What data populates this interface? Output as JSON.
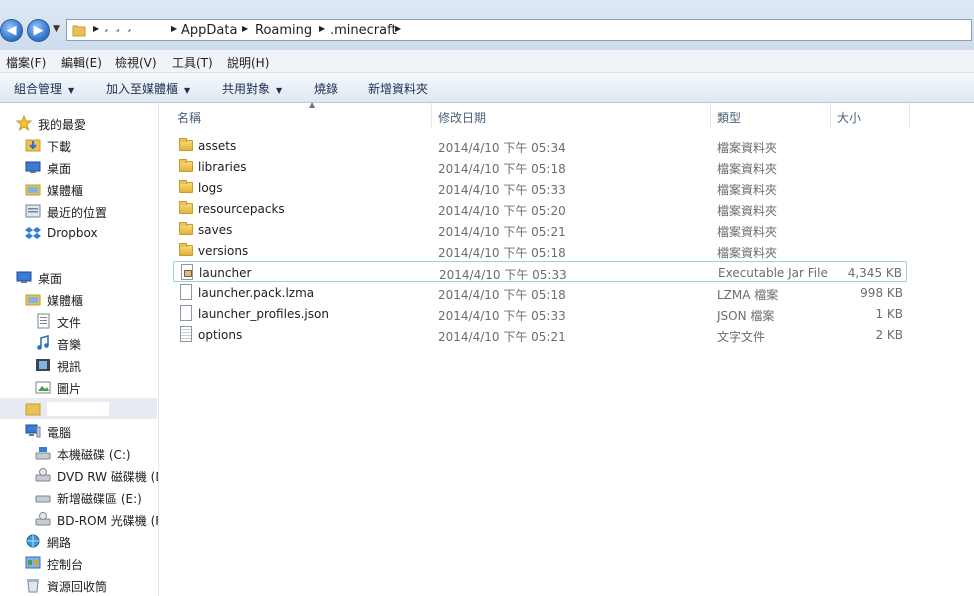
{
  "address": {
    "crumbs": [
      "AppData",
      "Roaming",
      ".minecraft"
    ]
  },
  "menu": [
    "檔案(F)",
    "編輯(E)",
    "檢視(V)",
    "工具(T)",
    "說明(H)"
  ],
  "commands": [
    "組合管理",
    "加入至媒體櫃",
    "共用對象",
    "燒錄",
    "新增資料夾"
  ],
  "nav": {
    "favorites": "我的最愛",
    "downloads": "下載",
    "desktop_fav": "桌面",
    "libraries_fav": "媒體櫃",
    "recent": "最近的位置",
    "dropbox": "Dropbox",
    "desktop": "桌面",
    "libraries": "媒體櫃",
    "documents": "文件",
    "music": "音樂",
    "videos": "視訊",
    "pictures": "圖片",
    "computer": "電腦",
    "drive_c": "本機磁碟 (C:)",
    "drive_dvd": "DVD RW 磁碟機 (D",
    "drive_e": "新增磁碟區 (E:)",
    "drive_bd": "BD-ROM 光碟機 (F",
    "network": "網路",
    "control_panel": "控制台",
    "recycle_bin": "資源回收筒"
  },
  "columns": {
    "name": "名稱",
    "date": "修改日期",
    "type": "類型",
    "size": "大小"
  },
  "files": [
    {
      "name": "assets",
      "date": "2014/4/10 下午 05:34",
      "type": "檔案資料夾",
      "size": "",
      "icon": "folder-icon"
    },
    {
      "name": "libraries",
      "date": "2014/4/10 下午 05:18",
      "type": "檔案資料夾",
      "size": "",
      "icon": "folder-icon"
    },
    {
      "name": "logs",
      "date": "2014/4/10 下午 05:33",
      "type": "檔案資料夾",
      "size": "",
      "icon": "folder-icon"
    },
    {
      "name": "resourcepacks",
      "date": "2014/4/10 下午 05:20",
      "type": "檔案資料夾",
      "size": "",
      "icon": "folder-icon"
    },
    {
      "name": "saves",
      "date": "2014/4/10 下午 05:21",
      "type": "檔案資料夾",
      "size": "",
      "icon": "folder-icon"
    },
    {
      "name": "versions",
      "date": "2014/4/10 下午 05:18",
      "type": "檔案資料夾",
      "size": "",
      "icon": "folder-icon"
    },
    {
      "name": "launcher",
      "date": "2014/4/10 下午 05:33",
      "type": "Executable Jar File",
      "size": "4,345 KB",
      "icon": "jar-file-icon"
    },
    {
      "name": "launcher.pack.lzma",
      "date": "2014/4/10 下午 05:18",
      "type": "LZMA 檔案",
      "size": "998 KB",
      "icon": "file-icon"
    },
    {
      "name": "launcher_profiles.json",
      "date": "2014/4/10 下午 05:33",
      "type": "JSON 檔案",
      "size": "1 KB",
      "icon": "file-icon"
    },
    {
      "name": "options",
      "date": "2014/4/10 下午 05:21",
      "type": "文字文件",
      "size": "2 KB",
      "icon": "text-file-icon"
    }
  ]
}
